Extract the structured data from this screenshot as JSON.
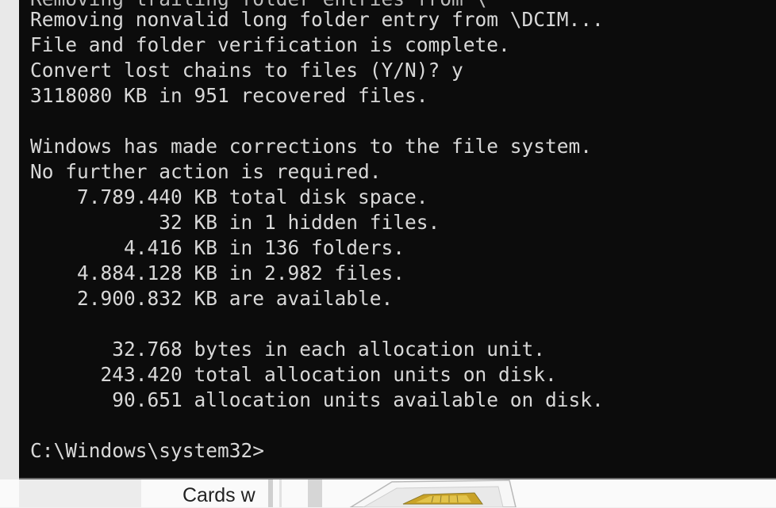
{
  "console": {
    "lines": [
      "Removing trailing folder entries from \\",
      "Removing nonvalid long folder entry from \\DCIM...",
      "File and folder verification is complete.",
      "Convert lost chains to files (Y/N)? y",
      "3118080 KB in 951 recovered files.",
      "",
      "Windows has made corrections to the file system.",
      "No further action is required.",
      "    7.789.440 KB total disk space.",
      "           32 KB in 1 hidden files.",
      "        4.416 KB in 136 folders.",
      "    4.884.128 KB in 2.982 files.",
      "    2.900.832 KB are available.",
      "",
      "       32.768 bytes in each allocation unit.",
      "      243.420 total allocation units on disk.",
      "       90.651 allocation units available on disk.",
      "",
      "C:\\Windows\\system32>"
    ]
  },
  "taskbar": {
    "label": "Cards w",
    "icon": "sd-card-icon"
  },
  "colors": {
    "console_bg": "#0c0c0c",
    "console_text": "#d8d8d8"
  }
}
